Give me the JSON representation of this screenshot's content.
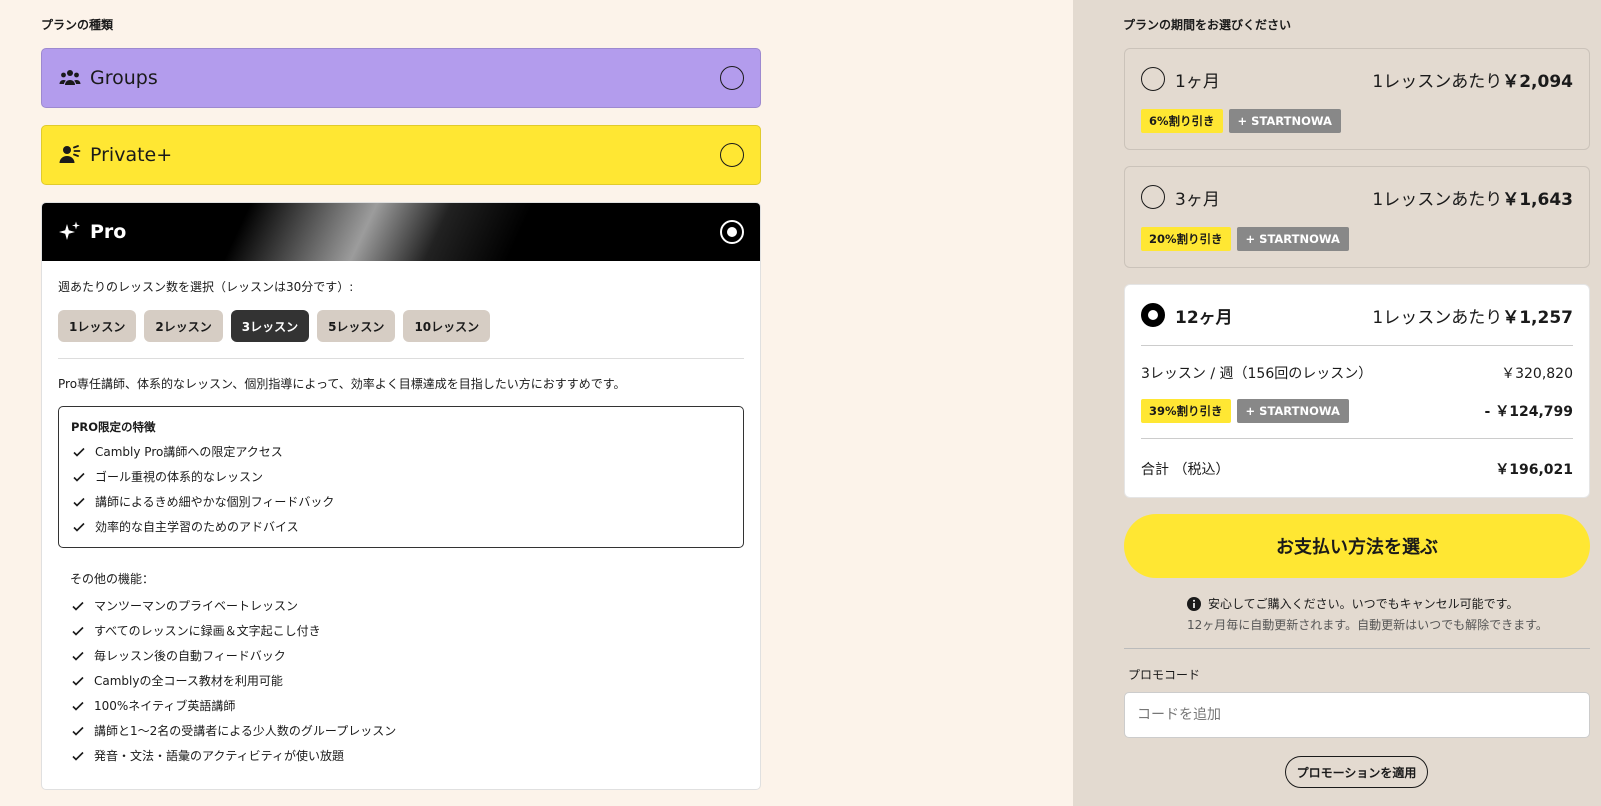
{
  "plan_type": {
    "title": "プランの種類",
    "groups": {
      "name": "Groups",
      "icon": "people-group-icon"
    },
    "private": {
      "name": "Private+",
      "icon": "person-speaking-icon"
    },
    "pro": {
      "name": "Pro",
      "icon": "sparkle-icon"
    }
  },
  "pro": {
    "weekly_label": "週あたりのレッスン数を選択（レッスンは30分です）:",
    "lessons": [
      "1レッスン",
      "2レッスン",
      "3レッスン",
      "5レッスン",
      "10レッスン"
    ],
    "selected_lesson": "3レッスン",
    "description": "Pro専任講師、体系的なレッスン、個別指導によって、効率よく目標達成を目指したい方におすすめです。",
    "features_title": "PRO限定の特徴",
    "features": [
      "Cambly Pro講師への限定アクセス",
      "ゴール重視の体系的なレッスン",
      "講師によるきめ細やかな個別フィードバック",
      "効率的な自主学習のためのアドバイス"
    ],
    "other_title": "その他の機能：",
    "other_features": [
      "マンツーマンのプライベートレッスン",
      "すべてのレッスンに録画＆文字起こし付き",
      "毎レッスン後の自動フィードバック",
      "Camblyの全コース教材を利用可能",
      "100%ネイティブ英語講師",
      "講師と1〜2名の受講者による少人数のグループレッスン",
      "発音・文法・語彙のアクティビティが使い放題"
    ]
  },
  "period": {
    "title": "プランの期間をお選びください",
    "options": [
      {
        "label": "1ヶ月",
        "per_prefix": "1レッスンあたり",
        "per_price": "￥2,094",
        "discount": "6%割り引き",
        "code": "+ STARTNOWA"
      },
      {
        "label": "3ヶ月",
        "per_prefix": "1レッスンあたり",
        "per_price": "￥1,643",
        "discount": "20%割り引き",
        "code": "+ STARTNOWA"
      },
      {
        "label": "12ヶ月",
        "per_prefix": "1レッスンあたり",
        "per_price": "￥1,257",
        "discount": "39%割り引き",
        "code": "+ STARTNOWA"
      }
    ],
    "selected": {
      "summary_label": "3レッスン / 週（156回のレッスン）",
      "summary_price": "￥320,820",
      "discount_amount": "- ￥124,799",
      "total_label": "合計 （税込）",
      "total_price": "￥196,021"
    }
  },
  "checkout": {
    "pay_button": "お支払い方法を選ぶ",
    "note1": "安心してご購入ください。いつでもキャンセル可能です。",
    "note2": "12ヶ月毎に自動更新されます。自動更新はいつでも解除できます。",
    "promo_label": "プロモコード",
    "promo_placeholder": "コードを追加",
    "promo_button": "プロモーションを適用"
  },
  "colors": {
    "left_bg": "#fcf3ea",
    "right_bg": "#e3dad0",
    "groups": "#b39ced",
    "private": "#ffe733",
    "accent_yellow": "#ffe733",
    "promo_grey": "#888888"
  }
}
